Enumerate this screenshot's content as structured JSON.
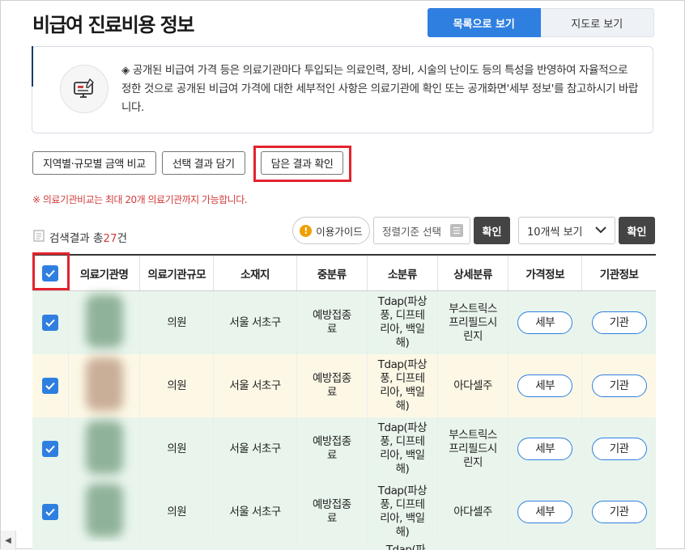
{
  "page": {
    "title": "비급여 진료비용 정보"
  },
  "view_toggle": {
    "list_label": "목록으로 보기",
    "map_label": "지도로 보기"
  },
  "notice": {
    "text": "◈ 공개된 비급여 가격 등은 의료기관마다 투입되는 의료인력, 장비, 시술의 난이도 등의 특성을 반영하여 자율적으로 정한 것으로 공개된 비급여 가격에 대한 세부적인 사항은 의료기관에 확인 또는 공개화면'세부 정보'를 참고하시기 바랍니다.",
    "icon": "monitor-icon"
  },
  "actions": {
    "compare_label": "지역별·규모별 금액 비교",
    "add_label": "선택 결과 담기",
    "check_label": "담은 결과 확인"
  },
  "warning": "※ 의료기관비교는 최대 20개 의료기관까지 가능합니다.",
  "results": {
    "prefix": "검색결과 총",
    "count": "27",
    "suffix": "건"
  },
  "toolbar": {
    "guide_label": "이용가이드",
    "sort_placeholder": "정렬기준 선택",
    "confirm_label": "확인",
    "page_size": "10개씩 보기",
    "confirm2_label": "확인"
  },
  "table": {
    "headers": [
      "의료기관명",
      "의료기관규모",
      "소재지",
      "중분류",
      "소분류",
      "상세분류",
      "가격정보",
      "기관정보"
    ],
    "rows": [
      {
        "scale": "의원",
        "location": "서울 서초구",
        "mid": "예방접종료",
        "sub": "Tdap(파상풍, 디프테리아, 백일해)",
        "detail": "부스트릭스프리필드시린지",
        "price_btn": "세부",
        "inst_btn": "기관",
        "checked": true,
        "bg": "#e9f5ec"
      },
      {
        "scale": "의원",
        "location": "서울 서초구",
        "mid": "예방접종료",
        "sub": "Tdap(파상풍, 디프테리아, 백일해)",
        "detail": "아다셀주",
        "price_btn": "세부",
        "inst_btn": "기관",
        "checked": true,
        "bg": "#fdf8e6"
      },
      {
        "scale": "의원",
        "location": "서울 서초구",
        "mid": "예방접종료",
        "sub": "Tdap(파상풍, 디프테리아, 백일해)",
        "detail": "부스트릭스프리필드시린지",
        "price_btn": "세부",
        "inst_btn": "기관",
        "checked": true,
        "bg": "#e9f5ec"
      },
      {
        "scale": "의원",
        "location": "서울 서초구",
        "mid": "예방접종료",
        "sub": "Tdap(파상풍, 디프테리아, 백일해)",
        "detail": "아다셀주",
        "price_btn": "세부",
        "inst_btn": "기관",
        "checked": true,
        "bg": "#e9f5ec"
      },
      {
        "scale": "",
        "location": "",
        "mid": "",
        "sub": "Tdap(파",
        "detail": "",
        "price_btn": "",
        "inst_btn": "",
        "checked": false,
        "bg": "#e9f5ec"
      }
    ]
  },
  "colors": {
    "accent": "#2f7fe0",
    "highlight": "#e3232f",
    "warning": "#d23c3c"
  }
}
